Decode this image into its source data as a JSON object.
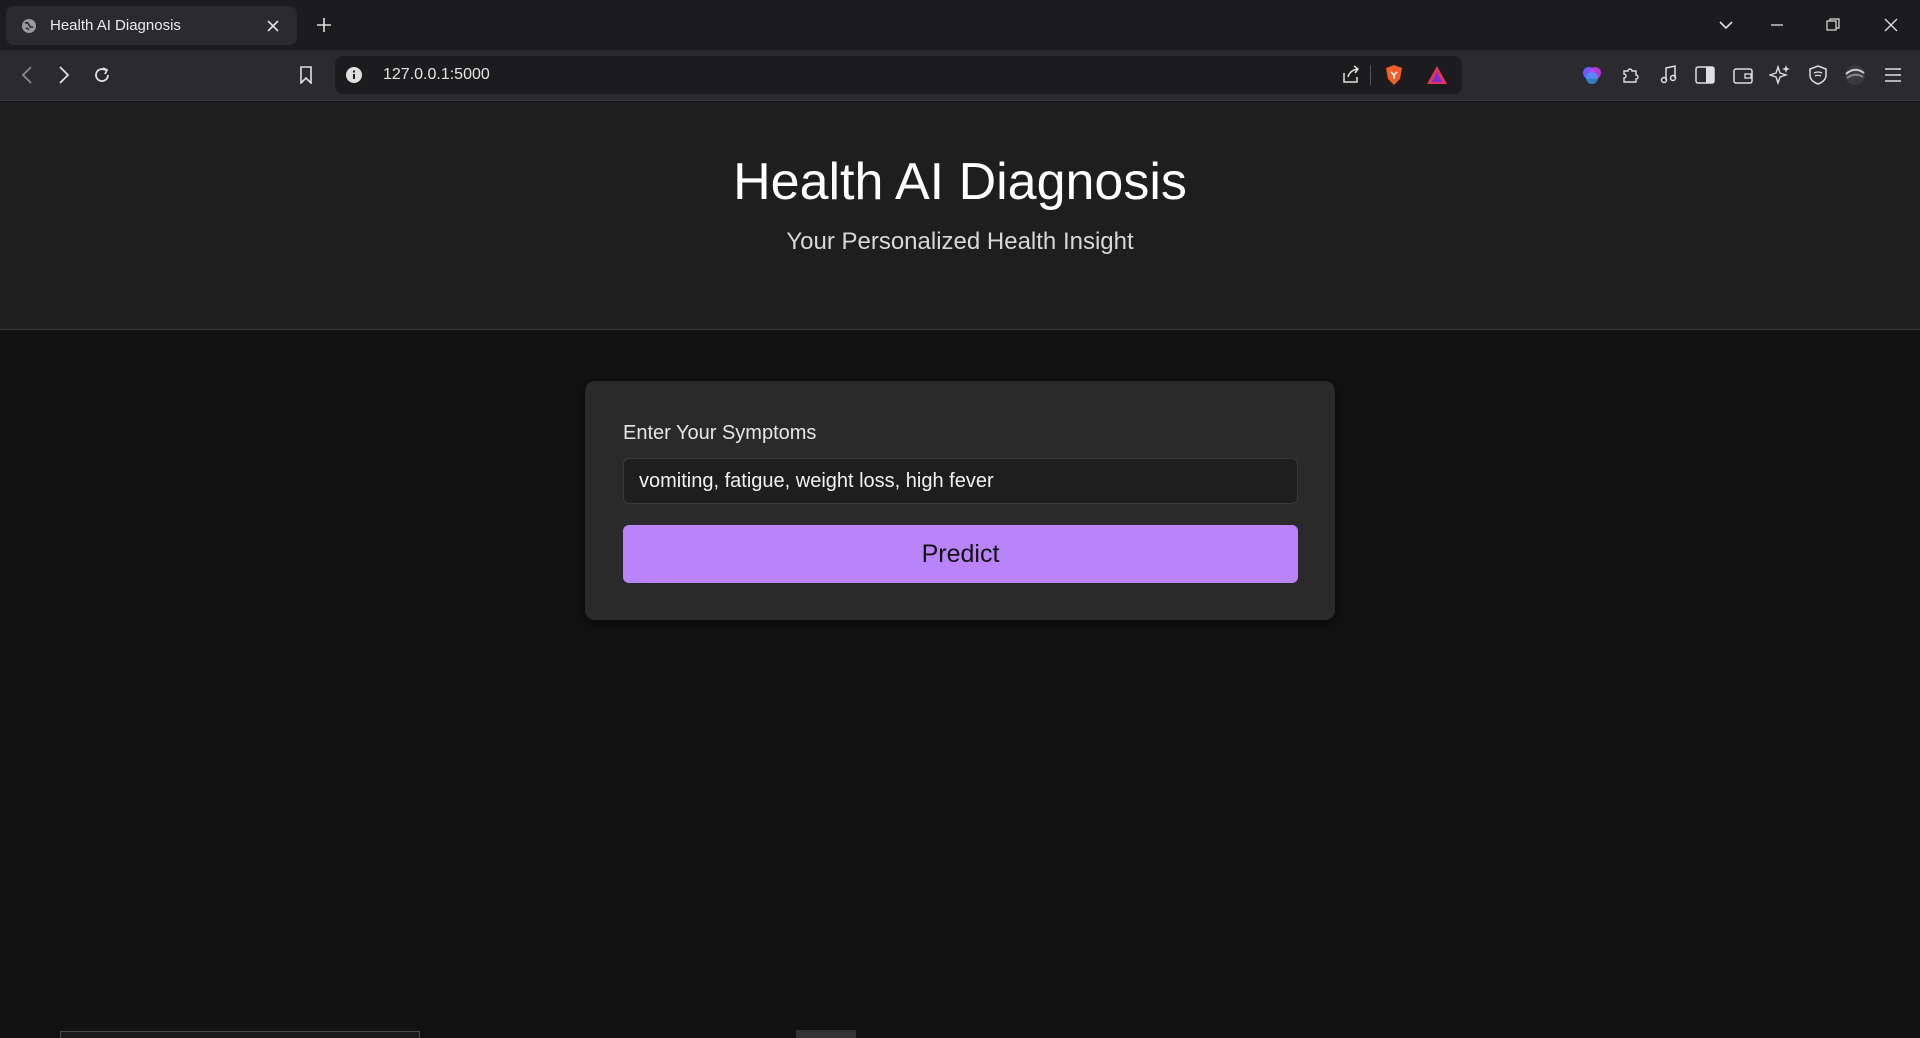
{
  "browser": {
    "tab_title": "Health AI Diagnosis",
    "url": "127.0.0.1:5000"
  },
  "header": {
    "title": "Health AI Diagnosis",
    "subtitle": "Your Personalized Health Insight"
  },
  "form": {
    "label": "Enter Your Symptoms",
    "input_value": "vomiting, fatigue, weight loss, high fever",
    "button_label": "Predict"
  },
  "colors": {
    "accent": "#b983f9",
    "page_bg": "#121212",
    "header_bg": "#1e1e1e",
    "card_bg": "#2a2a2a"
  }
}
